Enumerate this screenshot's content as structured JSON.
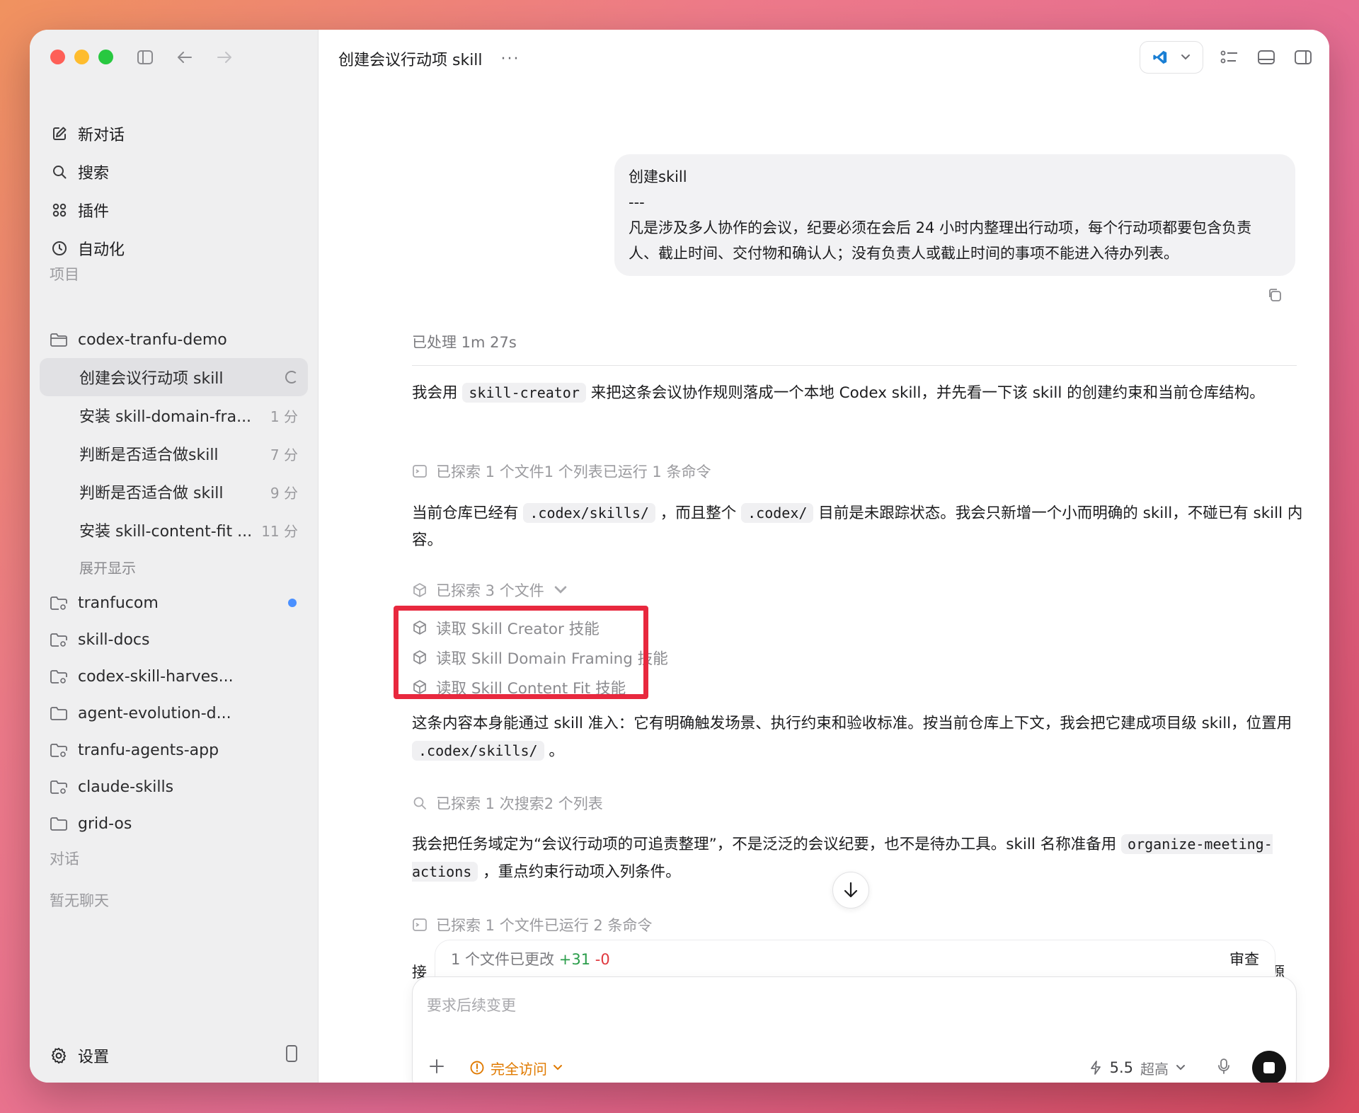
{
  "sidebar": {
    "nav": [
      {
        "label": "新对话",
        "icon": "edit-icon"
      },
      {
        "label": "搜索",
        "icon": "search-icon"
      },
      {
        "label": "插件",
        "icon": "plugins-icon"
      },
      {
        "label": "自动化",
        "icon": "clock-icon"
      }
    ],
    "projects_label": "项目",
    "active_project": "codex-tranfu-demo",
    "chats": [
      {
        "title": "创建会议行动项 skill",
        "time": ""
      },
      {
        "title": "安装 skill-domain-fra...",
        "time": "1 分"
      },
      {
        "title": "判断是否适合做skill",
        "time": "7 分"
      },
      {
        "title": "判断是否适合做 skill",
        "time": "9 分"
      },
      {
        "title": "安装 skill-content-fit ...",
        "time": "11 分"
      }
    ],
    "show_more": "展开显示",
    "projects": [
      "tranfucom",
      "skill-docs",
      "codex-skill-harves...",
      "agent-evolution-d...",
      "tranfu-agents-app",
      "claude-skills",
      "grid-os"
    ],
    "conversations_label": "对话",
    "no_chats": "暂无聊天",
    "settings": "设置"
  },
  "header": {
    "title": "创建会议行动项 skill",
    "more": "···"
  },
  "conversation": {
    "user_message": {
      "line1": "创建skill",
      "line2": "---",
      "line3": "凡是涉及多人协作的会议，纪要必须在会后 24 小时内整理出行动项，每个行动项都要包含负责人、截止时间、交付物和确认人；没有负责人或截止时间的事项不能进入待办列表。"
    },
    "processed": "已处理 1m 27s",
    "p1_a": "我会用",
    "p1_code": "skill-creator",
    "p1_b": "来把这条会议协作规则落成一个本地 Codex skill，并先看一下该 skill 的创建约束和当前仓库结构。",
    "meta1": "已探索 1 个文件1 个列表已运行 1 条命令",
    "p2_a": "当前仓库已经有",
    "p2_code1": ".codex/skills/",
    "p2_b": "，而且整个",
    "p2_code2": ".codex/",
    "p2_c": "目前是未跟踪状态。我会只新增一个小而明确的 skill，不碰已有 skill 内容。",
    "meta2": "已探索 3 个文件",
    "sub_items": [
      "读取 Skill Creator 技能",
      "读取 Skill Domain Framing 技能",
      "读取 Skill Content Fit 技能"
    ],
    "p3_a": "这条内容本身能通过 skill 准入：它有明确触发场景、执行约束和验收标准。按当前仓库上下文，我会把它建成项目级 skill，位置用",
    "p3_code": ".codex/skills/",
    "p3_b": "。",
    "meta3": "已探索 1 次搜索2 个列表",
    "p4_a": "我会把任务域定为“会议行动项的可追责整理”，不是泛泛的会议纪要，也不是待办工具。skill 名称准备用",
    "p4_code": "organize-meeting-actions",
    "p4_b": "，重点约束行动项入列条件。",
    "meta4": "已探索 1 个文件已运行 2 条命令",
    "trail_left": "接",
    "trail_right": "源"
  },
  "changes": {
    "text": "1 个文件已更改",
    "plus": "+31",
    "minus": "-0",
    "review": "审查"
  },
  "composer": {
    "placeholder": "要求后续变更",
    "access": "完全访问",
    "model": "5.5",
    "tier": "超高"
  },
  "colors": {
    "highlight": "#e8283e",
    "access": "#e07a00",
    "added": "#2a9d4a",
    "removed": "#e0383e",
    "unread_dot": "#4a90ff"
  }
}
